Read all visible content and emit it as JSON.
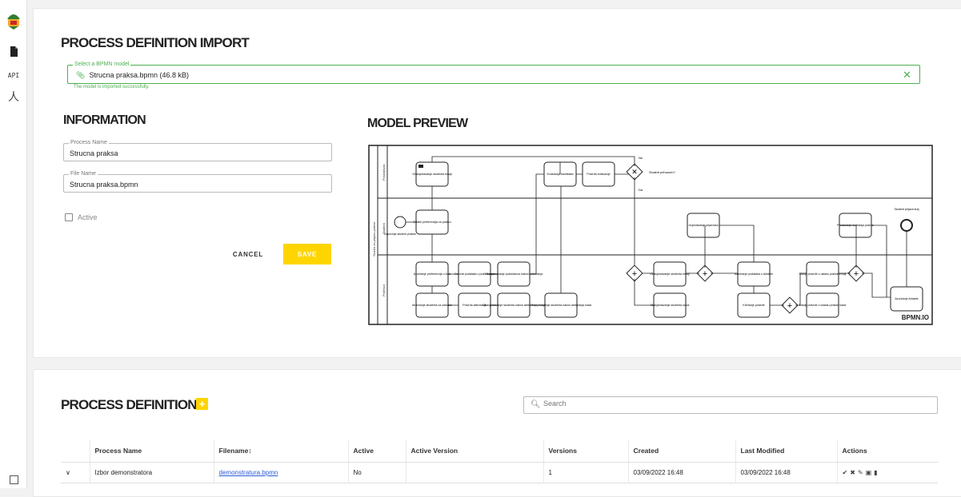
{
  "sidebar": {
    "api_label": "API"
  },
  "import": {
    "title": "PROCESS DEFINITION IMPORT",
    "bpmn_legend": "Select a BPMN model",
    "bpmn_value": "Strucna praksa.bpmn (46.8 kB)",
    "success_text": "The model is imported successfully."
  },
  "info": {
    "title": "INFORMATION",
    "process_name_legend": "Process Name",
    "process_name_value": "Strucna praksa",
    "file_name_legend": "File Name",
    "file_name_value": "Strucna praksa.bpmn",
    "active_label": "Active",
    "cancel_label": "CANCEL",
    "save_label": "SAVE"
  },
  "preview": {
    "title": "MODEL PREVIEW",
    "pool_label": "Sluzba za prijavu prakse",
    "lanes": [
      "Poslodavac",
      "Student",
      "Profesor"
    ],
    "tasks": [
      "Obavjestavanje studenta emajl",
      "Evaluacija kandidata",
      "Potvrda evaluacije",
      "Odabir preferencija za praksu",
      "Izvjestavanje prijavnica",
      "Predavanje izvjestaja prakse",
      "Azuriranje preferencija u bazi",
      "Dohvat podataka o poslodavcu",
      "Obavjestavanje poslodavca nakon aktiviranja",
      "Aktiviranje studenta na zadatak",
      "Potvrda aktiviranja",
      "Obavjestavanje studenta nakon aktiviranja emajl",
      "Obavjestavanje studenta nakon aktiviranja slack",
      "Obavjestavanje studenta emajl",
      "Obavjestavanje studenta slack",
      "Azuriranje podataka u Airtable",
      "Kreiranje potvrde",
      "Slanje potvrde o ulasku prakse emajl",
      "Slanje potvrde o izlasku prakse slack",
      "Azuriranje Airtable"
    ],
    "gateway_label": "Student prihvacen?",
    "yes_label": "Da",
    "no_label": "Ne",
    "start_label": "Zapocinje student prakse",
    "end_label": "Student prijava kraj",
    "watermark": "BPMN.IO"
  },
  "definitions": {
    "title": "PROCESS DEFINITIONS",
    "add_label": "+",
    "search_placeholder": "Search",
    "columns": [
      "",
      "Process Name",
      "Filename↕",
      "Active",
      "Active Version",
      "Versions",
      "Created",
      "Last Modified",
      "Actions"
    ],
    "rows": [
      {
        "expand": "∨",
        "process_name": "Izbor demonstratora",
        "filename": "demonstratura.bpmn",
        "active": "No",
        "active_version": "",
        "versions": "1",
        "created": "03/09/2022 16:48",
        "last_modified": "03/09/2022 16:48",
        "actions": [
          "check-icon",
          "cross-icon",
          "pencil-icon",
          "trash-icon",
          "file-icon"
        ]
      }
    ]
  }
}
